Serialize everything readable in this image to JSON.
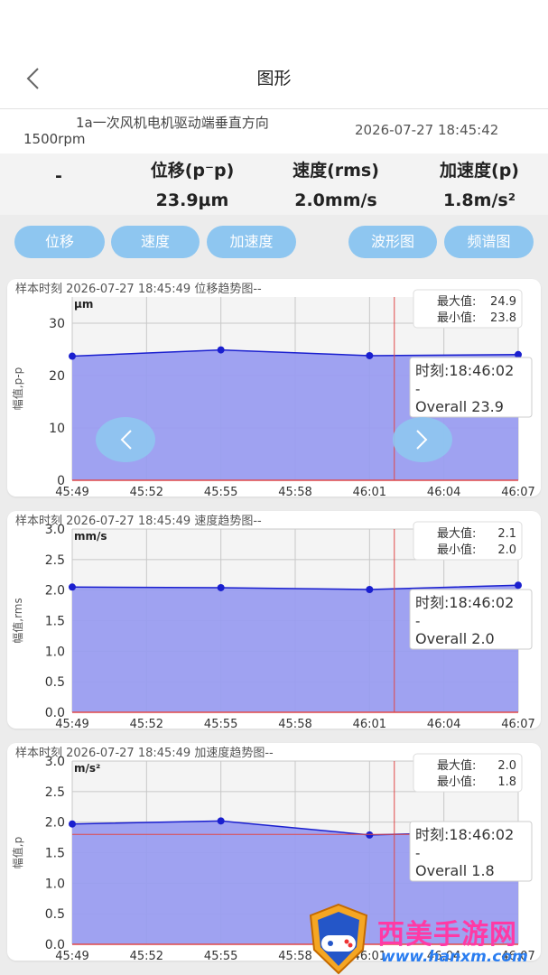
{
  "header": {
    "title": "图形"
  },
  "device": {
    "name": "1a一次风机电机驱动端垂直方向",
    "rpm": "1500rpm",
    "datetime": "2026-07-27 18:45:42"
  },
  "summary": {
    "col0": {
      "label": "",
      "value": "-"
    },
    "col1": {
      "label": "位移(p⁻p)",
      "value": "23.9µm"
    },
    "col2": {
      "label": "速度(rms)",
      "value": "2.0mm/s"
    },
    "col3": {
      "label": "加速度(p)",
      "value": "1.8m/s²"
    }
  },
  "buttons": {
    "displacement": "位移",
    "velocity": "速度",
    "acceleration": "加速度",
    "waveform": "波形图",
    "spectrum": "频谱图"
  },
  "colors": {
    "accent": "#8ec6f0",
    "fill": "#9a9df0",
    "line": "#1a1fcf",
    "marker_line": "#e04848"
  },
  "chart_data": [
    {
      "type": "area",
      "header": "样本时刻 2026-07-27 18:45:49 位移趋势图--",
      "unit": "µm",
      "ylabel": "幅值,p-p",
      "x": [
        "45:49",
        "45:55",
        "46:01",
        "46:07"
      ],
      "values": [
        23.7,
        24.9,
        23.8,
        24.0
      ],
      "ylim": [
        0,
        35
      ],
      "yticks": [
        "0",
        "10",
        "20",
        "30"
      ],
      "xticks": [
        "45:49",
        "45:52",
        "45:55",
        "45:58",
        "46:01",
        "46:04",
        "46:07"
      ],
      "max_label": "最大值:",
      "max_value": "24.9",
      "min_label": "最小值:",
      "min_value": "23.8",
      "tooltip_time": "时刻:18:46:02",
      "tooltip_dash": "-",
      "tooltip_overall": "Overall 23.9",
      "has_arrows": true
    },
    {
      "type": "area",
      "header": "样本时刻 2026-07-27 18:45:49 速度趋势图--",
      "unit": "mm/s",
      "ylabel": "幅值,rms",
      "x": [
        "45:49",
        "45:55",
        "46:01",
        "46:07"
      ],
      "values": [
        2.05,
        2.04,
        2.01,
        2.08
      ],
      "ylim": [
        0,
        3.0
      ],
      "yticks": [
        "0.0",
        "0.5",
        "1.0",
        "1.5",
        "2.0",
        "2.5",
        "3.0"
      ],
      "xticks": [
        "45:49",
        "45:52",
        "45:55",
        "45:58",
        "46:01",
        "46:04",
        "46:07"
      ],
      "max_label": "最大值:",
      "max_value": "2.1",
      "min_label": "最小值:",
      "min_value": "2.0",
      "tooltip_time": "时刻:18:46:02",
      "tooltip_dash": "-",
      "tooltip_overall": "Overall 2.0",
      "has_arrows": false
    },
    {
      "type": "area",
      "header": "样本时刻 2026-07-27 18:45:49 加速度趋势图--",
      "unit": "m/s²",
      "ylabel": "幅值,p",
      "x": [
        "45:49",
        "45:55",
        "46:01",
        "46:07"
      ],
      "values": [
        1.97,
        2.02,
        1.79,
        1.85
      ],
      "ylim": [
        0,
        3.0
      ],
      "yticks": [
        "0.0",
        "0.5",
        "1.0",
        "1.5",
        "2.0",
        "2.5",
        "3.0"
      ],
      "xticks": [
        "45:49",
        "45:52",
        "45:55",
        "45:58",
        "46:01",
        "46:04",
        "46:07"
      ],
      "max_label": "最大值:",
      "max_value": "2.0",
      "min_label": "最小值:",
      "min_value": "1.8",
      "tooltip_time": "时刻:18:46:02",
      "tooltip_dash": "-",
      "tooltip_overall": "Overall 1.8",
      "has_arrows": false
    }
  ],
  "watermark": {
    "text": "西美手游网",
    "url": "www.hanxm.com"
  }
}
